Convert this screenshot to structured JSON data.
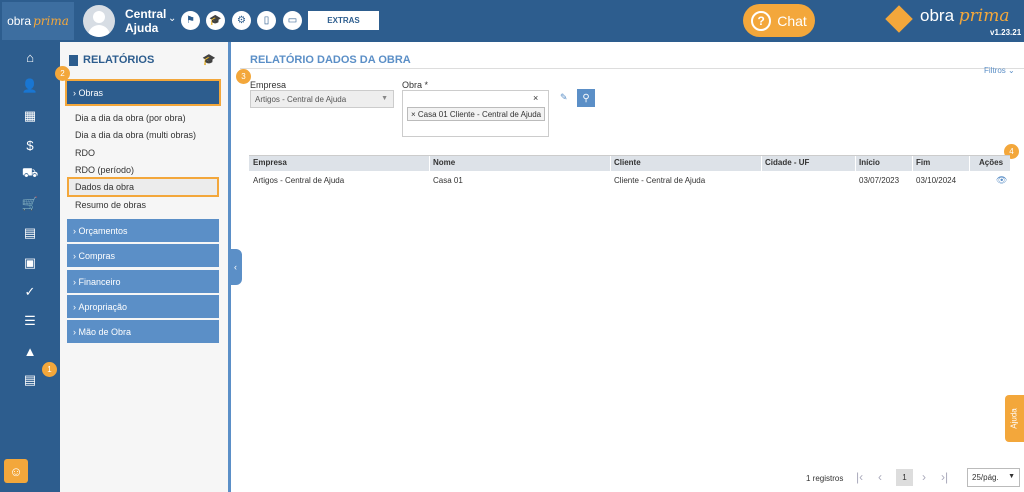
{
  "header": {
    "logo_text": "obra",
    "logo_italic": "prima",
    "user_name_line1": "Central",
    "user_name_line2": "Ajuda",
    "extras_label": "EXTRAS",
    "chat_label": "Chat",
    "brand_text": "obra",
    "brand_italic": "prima",
    "version": "v1.23.21",
    "icons": [
      "flag-icon",
      "graduation-cap-icon",
      "gear-icon",
      "mobile-icon",
      "monitor-icon"
    ]
  },
  "leftnav": {
    "icons": [
      "home-icon",
      "user-icon",
      "building-icon",
      "invoice-icon",
      "truck-icon",
      "cart-icon",
      "calculator-icon",
      "boxes-icon",
      "document-check-icon",
      "checklist-icon",
      "chart-icon",
      "report-icon"
    ]
  },
  "badges": {
    "b1": "1",
    "b2": "2",
    "b3": "3",
    "b4": "4"
  },
  "sidebar": {
    "title": "RELATÓRIOS",
    "active_section": "Obras",
    "sub_items": [
      "Dia a dia da obra (por obra)",
      "Dia a dia da obra (multi obras)",
      "RDO",
      "RDO (período)",
      "Dados da obra",
      "Resumo de obras"
    ],
    "sections": [
      "Orçamentos",
      "Compras",
      "Financeiro",
      "Apropriação",
      "Mão de Obra"
    ]
  },
  "main": {
    "title": "RELATÓRIO DADOS DA OBRA",
    "filters_label": "Filtros",
    "empresa_label": "Empresa",
    "empresa_value": "Artigos - Central de Ajuda",
    "obra_label": "Obra *",
    "obra_tag": "Casa 01 Cliente - Central de Ajuda",
    "clear_x": "×"
  },
  "table": {
    "headers": [
      "Empresa",
      "Nome",
      "Cliente",
      "Cidade - UF",
      "Início",
      "Fim",
      "Ações"
    ],
    "rows": [
      [
        "Artigos - Central de Ajuda",
        "Casa 01",
        "Cliente - Central de Ajuda",
        "",
        "03/07/2023",
        "03/10/2024"
      ]
    ]
  },
  "pager": {
    "count": "1 registros",
    "current": "1",
    "per_page": "25/pág."
  },
  "help_tab": "Ajuda"
}
